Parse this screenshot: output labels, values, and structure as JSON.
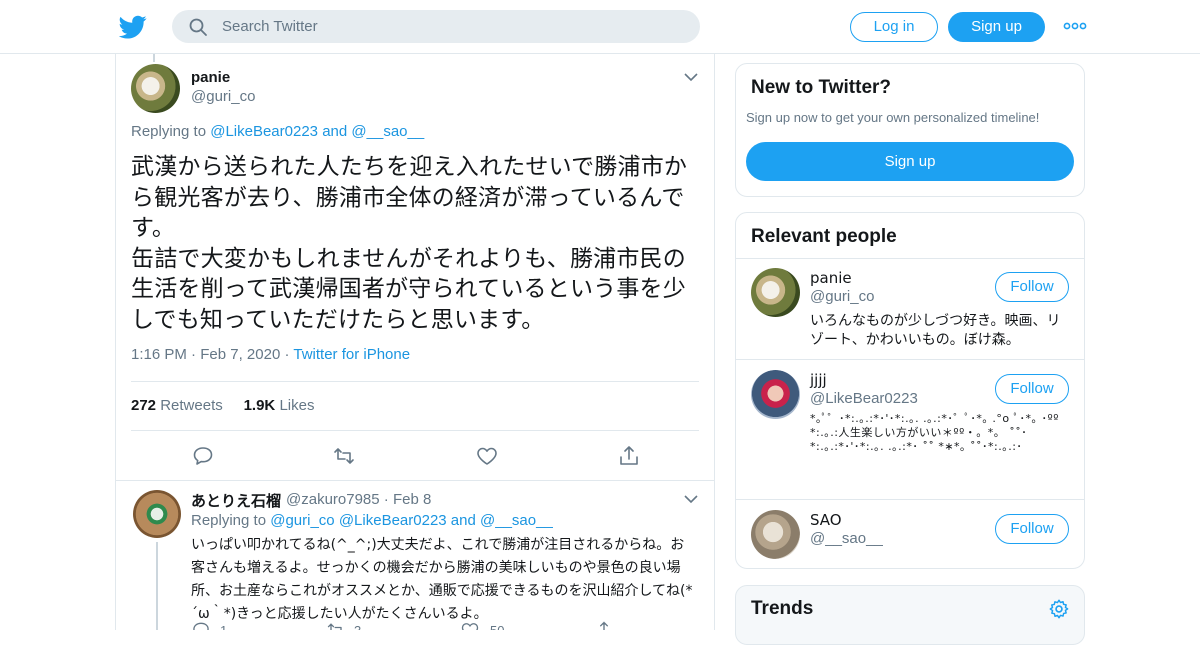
{
  "colors": {
    "accent": "#1da1f2",
    "link": "#1b95e0",
    "text": "#14171a",
    "muted": "#657786",
    "border": "#e1e8ed"
  },
  "header": {
    "search_placeholder": "Search Twitter",
    "login_label": "Log in",
    "signup_label": "Sign up",
    "icons": [
      "twitter-logo-icon",
      "search-icon",
      "more-icon"
    ]
  },
  "tweet": {
    "name": "panie",
    "handle": "@guri_co",
    "replying_to_prefix": "Replying to ",
    "replying_to_1": "@LikeBear0223",
    "replying_to_and": " and ",
    "replying_to_2": "@__sao__",
    "text": "武漢から送られた人たちを迎え入れたせいで勝浦市から観光客が去り、勝浦市全体の経済が滞っているんです。\n缶詰で大変かもしれませんがそれよりも、勝浦市民の生活を削って武漢帰国者が守られているという事を少しでも知っていただけたらと思います。",
    "time": "1:16 PM",
    "date": "Feb 7, 2020",
    "source": "Twitter for iPhone",
    "retweets_count": "272",
    "retweets_label": "Retweets",
    "likes_count": "1.9K",
    "likes_label": "Likes"
  },
  "reply": {
    "name": "あとりえ石榴",
    "handle": "@zakuro7985",
    "date": "Feb 8",
    "replying_to_prefix": "Replying to ",
    "replying_to_1": "@guri_co",
    "replying_to_2": "@LikeBear0223",
    "replying_to_and": " and ",
    "replying_to_3": "@__sao__",
    "text": "いっぱい叩かれてるね(^_^;)大丈夫だよ、これで勝浦が注目されるからね。お客さんも増えるよ。せっかくの機会だから勝浦の美味しいものや景色の良い場所、お土産ならこれがオススメとか、通販で応援できるものを沢山紹介してね(*´ω｀*)きっと応援したい人がたくさんいるよ。",
    "reply_count": "1",
    "retweet_count": "3",
    "like_count": "50"
  },
  "sidebar": {
    "new_title": "New to Twitter?",
    "new_subtitle": "Sign up now to get your own personalized timeline!",
    "new_signup": "Sign up",
    "relevant_title": "Relevant people",
    "follow_label": "Follow",
    "people": [
      {
        "name": "panie",
        "handle": "@guri_co",
        "bio": "いろんなものが少しづつ好き。映画、リゾート、かわいいもの。ぼけ森。"
      },
      {
        "name": "jjjj",
        "handle": "@LikeBear0223",
        "bio": "*｡ﾟ゜･*:.｡.:*･'･*:.｡. .｡.:*･゜ﾟ･*｡ .°o ﾟ･*｡ ･ºº *:.｡.:人生楽しい方がいい＊ºº・。*。 ˚˚･*:.｡.:*･'･*:.｡. .｡.:*･ ˚˚ *∗*｡ ˚˚･*:.｡.:･"
      },
      {
        "name": "SAO",
        "handle": "@__sao__",
        "bio": ""
      }
    ],
    "trends_title": "Trends"
  }
}
